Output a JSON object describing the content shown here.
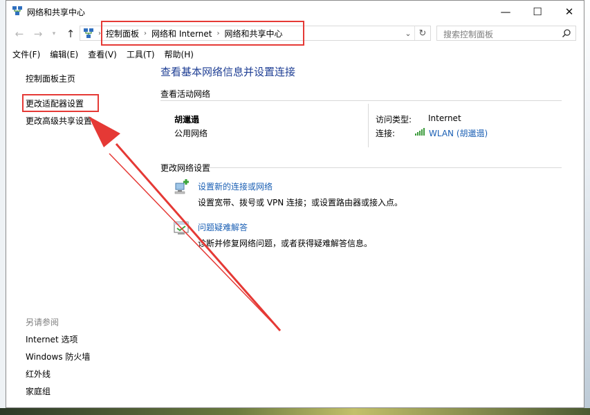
{
  "window": {
    "title": "网络和共享中心"
  },
  "breadcrumbs": [
    "控制面板",
    "网络和 Internet",
    "网络和共享中心"
  ],
  "search": {
    "placeholder": "搜索控制面板"
  },
  "menu": [
    "文件(F)",
    "编辑(E)",
    "查看(V)",
    "工具(T)",
    "帮助(H)"
  ],
  "sidebar": {
    "links": [
      "控制面板主页",
      "更改适配器设置",
      "更改高级共享设置"
    ],
    "see_also_label": "另请参阅",
    "see_also": [
      "Internet 选项",
      "Windows 防火墙",
      "红外线",
      "家庭组"
    ]
  },
  "main": {
    "heading": "查看基本网络信息并设置连接",
    "active_networks_label": "查看活动网络",
    "network": {
      "name": "胡邋遢",
      "type": "公用网络",
      "access_type_label": "访问类型:",
      "access_type_value": "Internet",
      "connection_label": "连接:",
      "connection_value": "WLAN (胡邋遢)"
    },
    "change_settings_label": "更改网络设置",
    "tasks": [
      {
        "title": "设置新的连接或网络",
        "desc": "设置宽带、拨号或 VPN 连接；或设置路由器或接入点。"
      },
      {
        "title": "问题疑难解答",
        "desc": "诊断并修复网络问题，或者获得疑难解答信息。"
      }
    ]
  },
  "colors": {
    "heading": "#1e3e94",
    "link": "#1a5fb4",
    "highlight": "#e53935"
  }
}
